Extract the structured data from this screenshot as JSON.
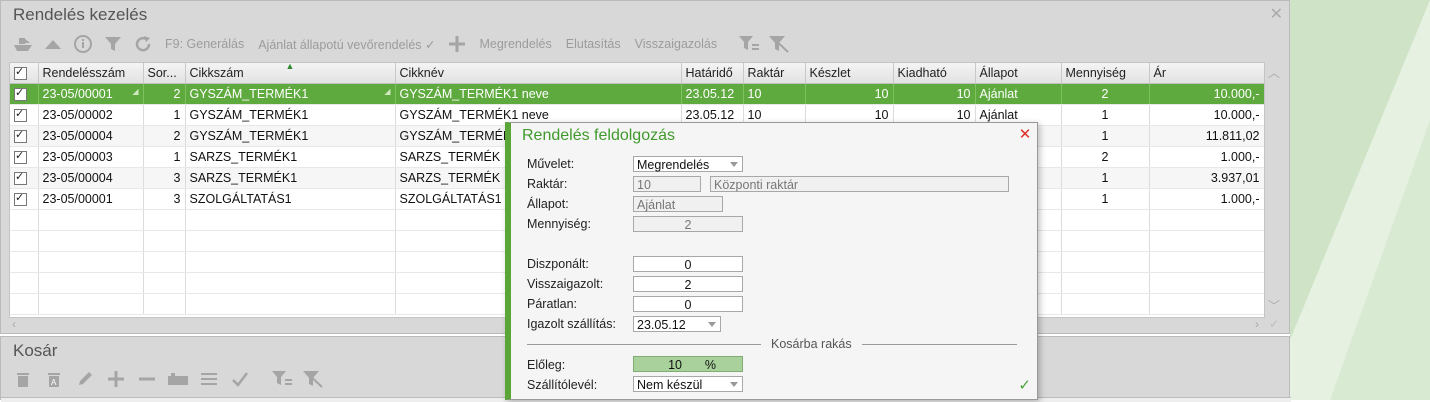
{
  "orders_panel": {
    "title": "Rendelés kezelés",
    "toolbar": {
      "generate": "F9: Generálás",
      "offer_to_order": "Ajánlat állapotú vevőrendelés ✓",
      "order": "Megrendelés",
      "reject": "Elutasítás",
      "confirm": "Visszaigazolás"
    },
    "columns": [
      "Rendelésszám",
      "Sor...",
      "Cikkszám",
      "Cikknév",
      "Határidő",
      "Raktár",
      "Készlet",
      "Kiadható",
      "Állapot",
      "Mennyiség",
      "Ár"
    ],
    "rows": [
      {
        "order": "23-05/00001",
        "line": "2",
        "code": "GYSZÁM_TERMÉK1",
        "name": "GYSZÁM_TERMÉK1 neve",
        "deadline": "23.05.12",
        "warehouse": "10",
        "stock": "10",
        "issuable": "10",
        "status": "Ajánlat",
        "qty": "2",
        "price": "10.000,-"
      },
      {
        "order": "23-05/00002",
        "line": "1",
        "code": "GYSZÁM_TERMÉK1",
        "name": "GYSZÁM_TERMÉK1 neve",
        "deadline": "23.05.12",
        "warehouse": "10",
        "stock": "10",
        "issuable": "10",
        "status": "Ajánlat",
        "qty": "1",
        "price": "10.000,-"
      },
      {
        "order": "23-05/00004",
        "line": "2",
        "code": "GYSZÁM_TERMÉK1",
        "name": "GYSZÁM_TERMÉK",
        "deadline": "",
        "warehouse": "",
        "stock": "",
        "issuable": "",
        "status": "",
        "qty": "1",
        "price": "11.811,02"
      },
      {
        "order": "23-05/00003",
        "line": "1",
        "code": "SARZS_TERMÉK1",
        "name": "SARZS_TERMÉK",
        "deadline": "",
        "warehouse": "",
        "stock": "",
        "issuable": "",
        "status": "",
        "qty": "2",
        "price": "1.000,-"
      },
      {
        "order": "23-05/00004",
        "line": "3",
        "code": "SARZS_TERMÉK1",
        "name": "SARZS_TERMÉK",
        "deadline": "",
        "warehouse": "",
        "stock": "",
        "issuable": "",
        "status": "",
        "qty": "1",
        "price": "3.937,01"
      },
      {
        "order": "23-05/00001",
        "line": "3",
        "code": "SZOLGÁLTATÁS1",
        "name": "SZOLGÁLTATÁS1",
        "deadline": "",
        "warehouse": "",
        "stock": "",
        "issuable": "",
        "status": "",
        "qty": "1",
        "price": "1.000,-"
      }
    ]
  },
  "cart_panel": {
    "title": "Kosár"
  },
  "dialog": {
    "title": "Rendelés feldolgozás",
    "labels": {
      "operation": "Művelet:",
      "warehouse": "Raktár:",
      "status": "Állapot:",
      "quantity": "Mennyiség:",
      "disposed": "Diszponált:",
      "confirmed": "Visszaigazolt:",
      "unpaired": "Páratlan:",
      "confirmed_delivery": "Igazolt szállítás:",
      "section": "Kosárba rakás",
      "advance": "Előleg:",
      "delivery_note": "Szállítólevél:"
    },
    "values": {
      "operation": "Megrendelés",
      "warehouse_code": "10",
      "warehouse_name": "Központi raktár",
      "status": "Ajánlat",
      "quantity": "2",
      "disposed": "0",
      "confirmed": "2",
      "unpaired": "0",
      "confirmed_delivery": "23.05.12",
      "advance": "10",
      "advance_unit": "%",
      "delivery_note": "Nem készül"
    }
  },
  "colors": {
    "accent": "#5aa537",
    "selected_row": "#5faa3f",
    "close_red": "#e0302a"
  }
}
